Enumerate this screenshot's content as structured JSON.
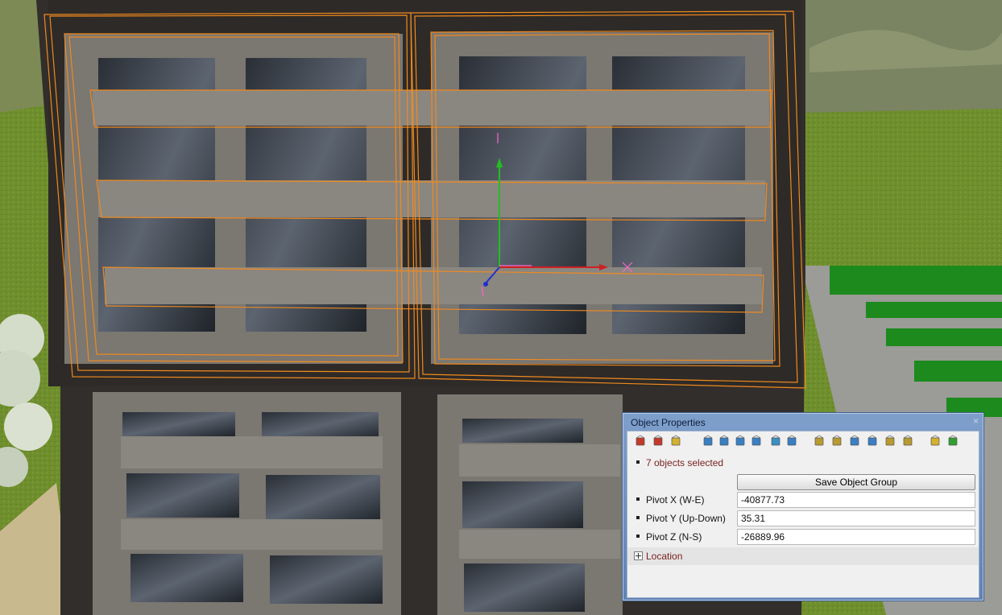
{
  "panel": {
    "title": "Object Properties",
    "close": "×",
    "selection_text": "7 objects selected",
    "save_button": "Save Object Group",
    "fields": [
      {
        "label": "Pivot X (W-E)",
        "value": "-40877.73"
      },
      {
        "label": "Pivot Y (Up-Down)",
        "value": "35.31"
      },
      {
        "label": "Pivot Z (N-S)",
        "value": "-26889.96"
      }
    ],
    "location_label": "Location",
    "toolbar_icons": [
      "delete-red-icon",
      "remove-red-x-icon",
      "box-yellow-icon",
      "pin-icon",
      "rotate-pin-icon",
      "move-left-icon",
      "move-right-icon",
      "hook-icon",
      "anchor-icon",
      "zoom-in-icon",
      "zoom-out-icon",
      "zoom-fit-icon",
      "zoom-select-icon",
      "zoom-region-icon",
      "zoom-reset-icon",
      "cylinder-icon",
      "chain-green-icon"
    ]
  },
  "colors": {
    "grass": "#6b8a3a",
    "building": "#3a3532",
    "frame": "#7a7670",
    "selection": "#f08a1e",
    "gizmo_x": "#d02020",
    "gizmo_y": "#20c020",
    "gizmo_z": "#2030d0"
  }
}
